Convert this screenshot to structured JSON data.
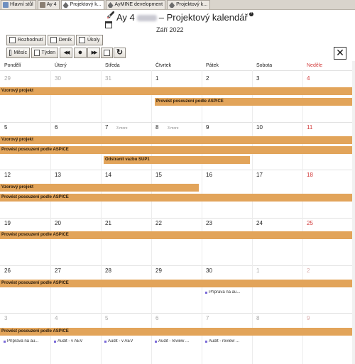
{
  "tabs": [
    {
      "label": "Hlavní stůl",
      "icon": "home-icon",
      "active": false
    },
    {
      "label": "Ay 4",
      "icon": "project-icon",
      "active": false
    },
    {
      "label": "Projektový k...",
      "icon": "rocket-icon",
      "active": true
    },
    {
      "label": "AyMINE development",
      "icon": "rocket-icon",
      "active": false
    },
    {
      "label": "Projektový k...",
      "icon": "rocket-icon",
      "active": false
    }
  ],
  "header": {
    "title_prefix": "Ay 4",
    "title_suffix": "– Projektový kalendář",
    "subtitle": "Září 2022"
  },
  "toolbar": {
    "decisions_label": "Rozhodnutí",
    "diary_label": "Deník",
    "tasks_label": "Úkoly",
    "month_label": "Měsíc",
    "week_label": "Týden",
    "prev_glyph": "◀◀",
    "today_glyph": "●",
    "next_glyph": "▶▶",
    "refresh_glyph": "↻",
    "close_glyph": "✕"
  },
  "weekdays": [
    "Pondělí",
    "Úterý",
    "Středa",
    "Čtvrtek",
    "Pátek",
    "Sobota",
    "Neděle"
  ],
  "weeks": [
    {
      "days": [
        "29",
        "30",
        "31",
        "1",
        "2",
        "3",
        "4"
      ],
      "other": [
        true,
        true,
        true,
        false,
        false,
        false,
        false
      ]
    },
    {
      "days": [
        "5",
        "6",
        "7",
        "8",
        "9",
        "10",
        "11"
      ],
      "other": [
        false,
        false,
        false,
        false,
        false,
        false,
        false
      ]
    },
    {
      "days": [
        "12",
        "13",
        "14",
        "15",
        "16",
        "17",
        "18"
      ],
      "other": [
        false,
        false,
        false,
        false,
        false,
        false,
        false
      ]
    },
    {
      "days": [
        "19",
        "20",
        "21",
        "22",
        "23",
        "24",
        "25"
      ],
      "other": [
        false,
        false,
        false,
        false,
        false,
        false,
        false
      ]
    },
    {
      "days": [
        "26",
        "27",
        "28",
        "29",
        "30",
        "1",
        "2"
      ],
      "other": [
        false,
        false,
        false,
        false,
        false,
        true,
        true
      ]
    },
    {
      "days": [
        "3",
        "4",
        "5",
        "6",
        "7",
        "8",
        "9"
      ],
      "other": [
        true,
        true,
        true,
        true,
        true,
        true,
        true
      ]
    }
  ],
  "more_labels": {
    "w1_wed": "3 more",
    "w1_thu": "3 more"
  },
  "events": {
    "vzorovy": "Vzorový projekt",
    "aspice": "Provést posouzení podle ASPICE",
    "sup1": "Odstranit vazbu SUP1",
    "priprava": "Příprava na au...",
    "audit_av": "Audit - v AEV",
    "audit_av2": "Audit - v AEV",
    "audit_review": "Audit - review ...",
    "audit_review2": "Audit - review ..."
  }
}
